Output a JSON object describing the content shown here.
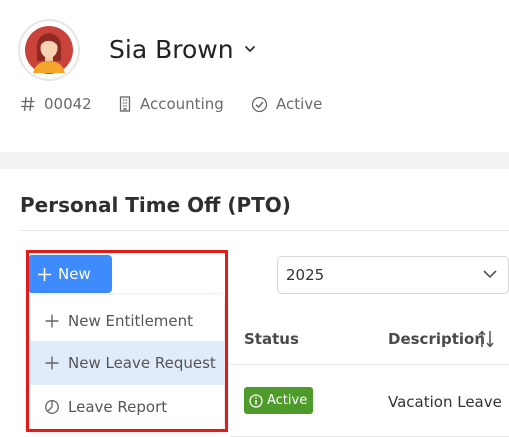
{
  "profile": {
    "name": "Sia Brown",
    "employee_id": "00042",
    "department": "Accounting",
    "status": "Active",
    "icons": {
      "id": "hash-icon",
      "department": "building-icon",
      "status": "check-circle-icon"
    }
  },
  "pto": {
    "title": "Personal Time Off (PTO)",
    "new_button_label": "New",
    "year_selected": "2025",
    "menu": [
      {
        "label": "New Entitlement",
        "icon": "plus-icon",
        "highlighted": false
      },
      {
        "label": "New Leave Request",
        "icon": "plus-icon",
        "highlighted": true
      },
      {
        "label": "Leave Report",
        "icon": "pie-chart-icon",
        "highlighted": false
      }
    ],
    "table": {
      "headers": {
        "status": "Status",
        "description": "Description"
      },
      "rows": [
        {
          "status": "Active",
          "description": "Vacation Leave"
        }
      ]
    }
  },
  "colors": {
    "primary": "#3d8bfd",
    "active_badge": "#4e9a2b",
    "highlight": "#e0ecfa",
    "frame": "#e01b1b"
  }
}
